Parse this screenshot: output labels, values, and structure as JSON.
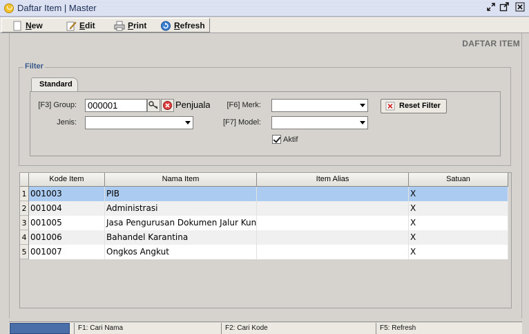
{
  "window": {
    "title": "Daftar Item | Master"
  },
  "toolbar": {
    "new_label": "New",
    "edit_label": "Edit",
    "print_label": "Print",
    "refresh_label": "Refresh"
  },
  "page": {
    "heading": "DAFTAR ITEM"
  },
  "filter": {
    "legend": "Filter",
    "tab_label": "Standard",
    "group_label": "[F3] Group:",
    "group_value": "000001",
    "group_name": "Penjualan",
    "jenis_label": "Jenis:",
    "jenis_value": "",
    "merk_label": "[F6] Merk:",
    "merk_value": "",
    "model_label": "[F7] Model:",
    "model_value": "",
    "aktif_label": "Aktif",
    "aktif_checked": true,
    "reset_label": "Reset Filter"
  },
  "grid": {
    "columns": [
      "Kode Item",
      "Nama Item",
      "Item Alias",
      "Satuan"
    ],
    "rows": [
      {
        "no": "1",
        "kode": "001003",
        "nama": "PIB",
        "alias": "",
        "satuan": "X"
      },
      {
        "no": "2",
        "kode": "001004",
        "nama": "Administrasi",
        "alias": "",
        "satuan": "X"
      },
      {
        "no": "3",
        "kode": "001005",
        "nama": "Jasa Pengurusan Dokumen Jalur Kuning",
        "alias": "",
        "satuan": "X"
      },
      {
        "no": "4",
        "kode": "001006",
        "nama": "Bahandel Karantina",
        "alias": "",
        "satuan": "X"
      },
      {
        "no": "5",
        "kode": "001007",
        "nama": "Ongkos Angkut",
        "alias": "",
        "satuan": "X"
      }
    ]
  },
  "statusbar": {
    "f1": "F1: Cari Nama",
    "f2": "F2: Cari Kode",
    "f5": "F5: Refresh"
  },
  "colors": {
    "selected_row": "#abcbf0",
    "legend": "#3a5a8c",
    "status_block": "#4a6ea8"
  }
}
